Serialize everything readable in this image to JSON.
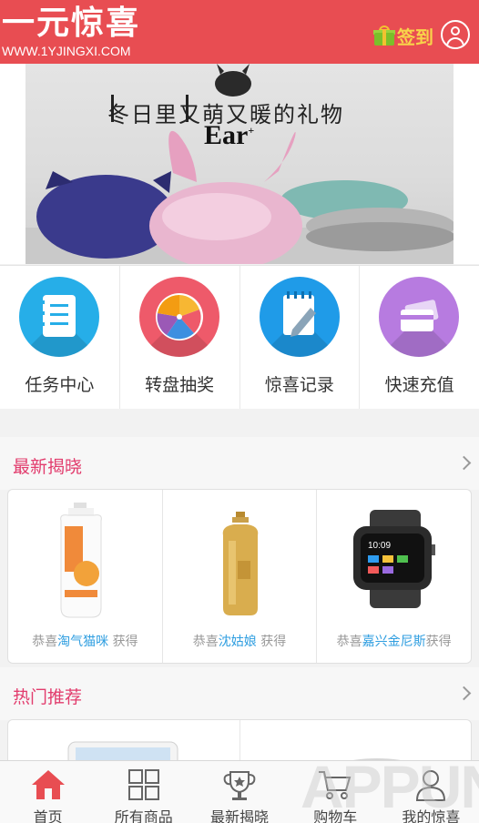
{
  "header": {
    "logo_cn": "一元惊喜",
    "logo_en": "WWW.1YJINGXI.COM",
    "checkin_label": "签到"
  },
  "banner": {
    "title": "冬日里又萌又暖的礼物",
    "subtitle": "Ear",
    "subtitle_sup": "+"
  },
  "quick_actions": [
    {
      "label": "任务中心",
      "color": "#26aee8",
      "icon": "task-list-icon"
    },
    {
      "label": "转盘抽奖",
      "color": "#ee5a6a",
      "icon": "wheel-icon"
    },
    {
      "label": "惊喜记录",
      "color": "#1f9be8",
      "icon": "notebook-icon"
    },
    {
      "label": "快速充值",
      "color": "#b77be0",
      "icon": "card-icon"
    }
  ],
  "latest": {
    "title": "最新揭晓",
    "items": [
      {
        "prefix": "恭喜",
        "name": "淘气猫咪",
        "suffix": "获得",
        "product": "shampoo-bottle"
      },
      {
        "prefix": "恭喜",
        "name": "沈姑娘",
        "suffix": "获得",
        "product": "gold-bottle"
      },
      {
        "prefix": "恭喜",
        "name": "嘉兴金尼斯",
        "suffix": "获得",
        "product": "smart-watch"
      }
    ]
  },
  "hot": {
    "title": "热门推荐"
  },
  "tabbar": [
    {
      "label": "首页",
      "icon": "home-icon",
      "active": true
    },
    {
      "label": "所有商品",
      "icon": "grid-icon",
      "active": false
    },
    {
      "label": "最新揭晓",
      "icon": "trophy-icon",
      "active": false
    },
    {
      "label": "购物车",
      "icon": "cart-icon",
      "active": false
    },
    {
      "label": "我的惊喜",
      "icon": "profile-icon",
      "active": false
    }
  ],
  "colors": {
    "brand": "#e84d52",
    "section_title": "#e23c6d",
    "highlight_name": "#2f9ee0"
  }
}
